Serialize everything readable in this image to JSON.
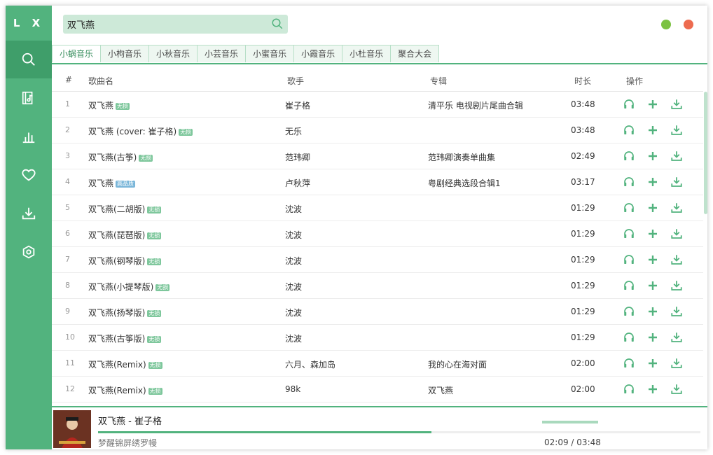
{
  "sidebar": {
    "logo": "L X",
    "items": [
      {
        "name": "search",
        "icon": "search-icon",
        "active": true
      },
      {
        "name": "song-list",
        "icon": "music-list-icon"
      },
      {
        "name": "charts",
        "icon": "bar-chart-icon"
      },
      {
        "name": "favorites",
        "icon": "heart-icon"
      },
      {
        "name": "download",
        "icon": "download-icon"
      },
      {
        "name": "settings",
        "icon": "settings-icon"
      }
    ]
  },
  "search": {
    "value": "双飞燕"
  },
  "tabs": [
    "小蜗音乐",
    "小枸音乐",
    "小秋音乐",
    "小芸音乐",
    "小蜜音乐",
    "小霞音乐",
    "小杜音乐",
    "聚合大会"
  ],
  "table": {
    "headers": {
      "num": "#",
      "name": "歌曲名",
      "artist": "歌手",
      "album": "专辑",
      "duration": "时长",
      "ops": "操作"
    },
    "rows": [
      {
        "num": "1",
        "name": "双飞燕",
        "badge": "无损",
        "artist": "崔子格",
        "album": "清平乐 电视剧片尾曲合辑",
        "duration": "03:48"
      },
      {
        "num": "2",
        "name": "双飞燕 (cover: 崔子格)",
        "badge": "无损",
        "artist": "无乐",
        "album": "",
        "duration": "03:48"
      },
      {
        "num": "3",
        "name": "双飞燕(古筝)",
        "badge": "无损",
        "artist": "范玮卿",
        "album": "范玮卿演奏单曲集",
        "duration": "02:49"
      },
      {
        "num": "4",
        "name": "双飞燕",
        "badge": "高品质",
        "artist": "卢秋萍",
        "album": "粤剧经典选段合辑1",
        "duration": "03:17"
      },
      {
        "num": "5",
        "name": "双飞燕(二胡版)",
        "badge": "无损",
        "artist": "沈波",
        "album": "",
        "duration": "01:29"
      },
      {
        "num": "6",
        "name": "双飞燕(琵琶版)",
        "badge": "无损",
        "artist": "沈波",
        "album": "",
        "duration": "01:29"
      },
      {
        "num": "7",
        "name": "双飞燕(钢琴版)",
        "badge": "无损",
        "artist": "沈波",
        "album": "",
        "duration": "01:29"
      },
      {
        "num": "8",
        "name": "双飞燕(小提琴版)",
        "badge": "无损",
        "artist": "沈波",
        "album": "",
        "duration": "01:29"
      },
      {
        "num": "9",
        "name": "双飞燕(扬琴版)",
        "badge": "无损",
        "artist": "沈波",
        "album": "",
        "duration": "01:29"
      },
      {
        "num": "10",
        "name": "双飞燕(古筝版)",
        "badge": "无损",
        "artist": "沈波",
        "album": "",
        "duration": "01:29"
      },
      {
        "num": "11",
        "name": "双飞燕(Remix)",
        "badge": "无损",
        "artist": "六月、森加岛",
        "album": "我的心在海对面",
        "duration": "02:00"
      },
      {
        "num": "12",
        "name": "双飞燕(Remix)",
        "badge": "无损",
        "artist": "98k",
        "album": "双飞燕",
        "duration": "02:00"
      }
    ],
    "row_actions": [
      "headphones-icon",
      "plus-icon",
      "download-icon"
    ]
  },
  "player": {
    "title": "双飞燕 - 崔子格",
    "lyric": "梦醒锦屏绣罗幔",
    "current_time": "02:09",
    "separator": "/",
    "total_time": "03:48",
    "progress": 0.553,
    "volume": 1.0
  },
  "colors": {
    "accent": "#52b37e",
    "accent_dark": "#3f9e6a",
    "minimize": "#7cc242",
    "close": "#ed6b4f"
  }
}
